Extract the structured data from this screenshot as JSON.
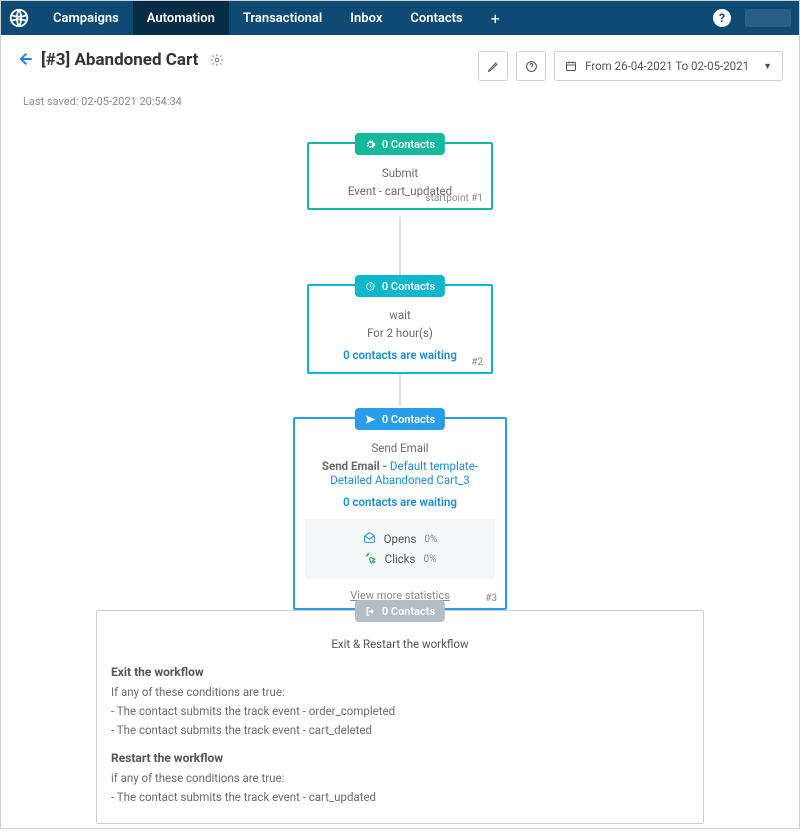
{
  "nav": {
    "items": [
      "Campaigns",
      "Automation",
      "Transactional",
      "Inbox",
      "Contacts"
    ],
    "active_index": 1
  },
  "header": {
    "title": "[#3] Abandoned Cart",
    "last_saved": "Last saved: 02-05-2021 20:54:34",
    "date_range": "From 26-04-2021 To 02-05-2021"
  },
  "nodes": {
    "start": {
      "badge": "0 Contacts",
      "title": "Submit",
      "subtitle": "Event - cart_updated",
      "tag": "startpoint #1"
    },
    "wait": {
      "badge": "0 Contacts",
      "title": "wait",
      "subtitle": "For 2 hour(s)",
      "waiting": "0 contacts are waiting",
      "tag": "#2"
    },
    "email": {
      "badge": "0 Contacts",
      "title": "Send Email",
      "prefix": "Send Email - ",
      "template": "Default template-Detailed Abandoned Cart_3",
      "waiting": "0 contacts are waiting",
      "opens_label": "Opens",
      "opens_val": "0%",
      "clicks_label": "Clicks",
      "clicks_val": "0%",
      "more": "View more statistics",
      "tag": "#3"
    },
    "exit": {
      "badge": "0 Contacts",
      "title": "Exit & Restart the workflow",
      "exit_heading": "Exit the workflow",
      "exit_cond_intro": "If any of these conditions are true:",
      "exit_conds": [
        "- The contact submits the track event - order_completed",
        "- The contact submits the track event - cart_deleted"
      ],
      "restart_heading": "Restart the workflow",
      "restart_cond_intro": "if any of these conditions are true:",
      "restart_conds": [
        "- The contact submits the track event - cart_updated"
      ]
    }
  }
}
